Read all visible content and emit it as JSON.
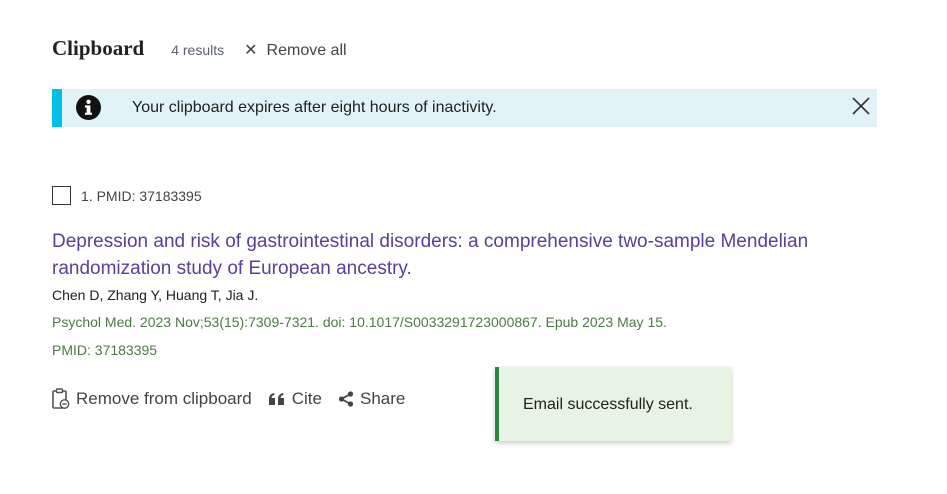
{
  "clipboard": {
    "title": "Clipboard",
    "results": "4 results",
    "remove_all": "Remove all",
    "remove_all_icon": "close-icon"
  },
  "alert": {
    "message": "Your clipboard expires after eight hours of inactivity.",
    "icon": "info-circle-icon",
    "close_icon": "close-icon",
    "accent_color": "#02bfe7",
    "background": "#e1f3f8"
  },
  "article": {
    "number_label": "1. PMID: 37183395",
    "title": "Depression and risk of gastrointestinal disorders: a comprehensive two-sample Mendelian randomization study of European ancestry.",
    "authors": "Chen D, Zhang Y, Huang T, Jia J.",
    "citation": "Psychol Med. 2023 Nov;53(15):7309-7321. doi: 10.1017/S0033291723000867. Epub 2023 May 15.",
    "pmid": "PMID: 37183395",
    "title_color": "#5b3f96",
    "citation_color": "#4d7a44"
  },
  "actions": {
    "remove_label": "Remove from clipboard",
    "cite_label": "Cite",
    "share_label": "Share"
  },
  "toast": {
    "message": "Email successfully sent.",
    "accent_color": "#2e8540"
  }
}
